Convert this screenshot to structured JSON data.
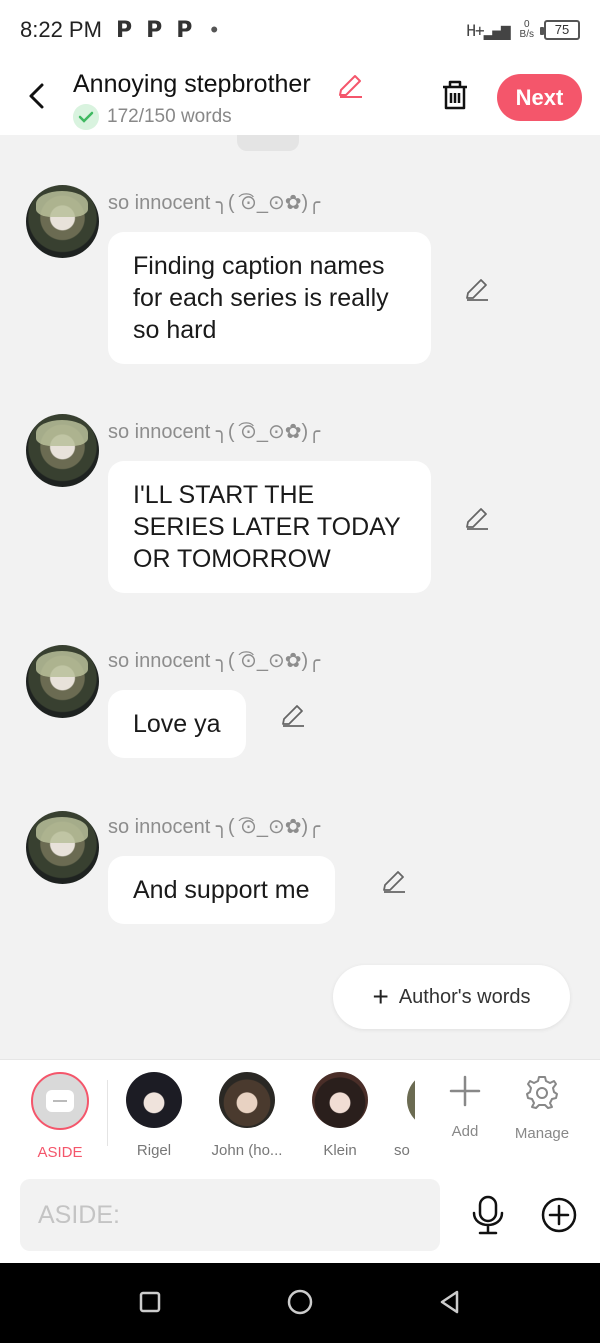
{
  "status_bar": {
    "time": "8:22 PM",
    "notif_icons": [
      "P",
      "P",
      "P"
    ],
    "dot": "•",
    "network": "H+",
    "data_rate_value": "0",
    "data_rate_unit": "B/s",
    "battery": "75"
  },
  "header": {
    "title": "Annoying stepbrother",
    "word_count": "172/150 words",
    "next_label": "Next"
  },
  "messages": [
    {
      "sender": "so innocent ╮( ͡⊙_⊙✿)╭",
      "text": "Finding caption names for each series is really so hard"
    },
    {
      "sender": "so innocent ╮( ͡⊙_⊙✿)╭",
      "text": "I'LL START THE SERIES LATER TODAY OR TOMORROW"
    },
    {
      "sender": "so innocent ╮( ͡⊙_⊙✿)╭",
      "text": "Love ya"
    },
    {
      "sender": "so innocent ╮( ͡⊙_⊙✿)╭",
      "text": "And support me"
    }
  ],
  "authors_words_label": "Author's words",
  "characters": {
    "aside": "ASIDE",
    "list": [
      "Rigel",
      "John (ho...",
      "Klein",
      "so i"
    ],
    "add_label": "Add",
    "manage_label": "Manage"
  },
  "input": {
    "placeholder": "ASIDE:"
  },
  "colors": {
    "accent": "#f4566b",
    "background": "#f2f2f2",
    "bubble": "#ffffff"
  }
}
